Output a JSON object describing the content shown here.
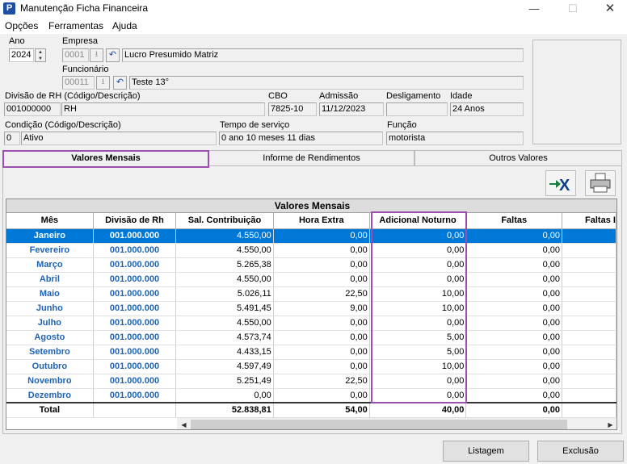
{
  "window": {
    "title": "Manutenção Ficha Financeira",
    "app_icon_letter": "P"
  },
  "menu": [
    "Opções",
    "Ferramentas",
    "Ajuda"
  ],
  "form": {
    "ano_label": "Ano",
    "ano_value": "2024",
    "empresa_label": "Empresa",
    "empresa_code": "0001",
    "empresa_name": "Lucro Presumido Matriz",
    "funcionario_label": "Funcionário",
    "funcionario_code": "00011",
    "funcionario_name": "Teste 13°",
    "divisao_label": "Divisão de RH (Código/Descrição)",
    "divisao_code": "001000000",
    "divisao_desc": "RH",
    "cbo_label": "CBO",
    "cbo_value": "7825-10",
    "admissao_label": "Admissão",
    "admissao_value": "11/12/2023",
    "desligamento_label": "Desligamento",
    "desligamento_value": "",
    "idade_label": "Idade",
    "idade_value": "24 Anos",
    "condicao_label": "Condição (Código/Descrição)",
    "condicao_code": "0",
    "condicao_desc": "Ativo",
    "tempo_label": "Tempo de serviço",
    "tempo_value": "0 ano 10 meses 11 dias",
    "funcao_label": "Função",
    "funcao_value": "motorista"
  },
  "tabs": [
    "Valores Mensais",
    "Informe de Rendimentos",
    "Outros Valores"
  ],
  "grid": {
    "title": "Valores Mensais",
    "columns": [
      "Mês",
      "Divisão de Rh",
      "Sal. Contribuição",
      "Hora Extra",
      "Adicional Noturno",
      "Faltas",
      "Faltas I"
    ],
    "rows": [
      [
        "Janeiro",
        "001.000.000",
        "4.550,00",
        "0,00",
        "0,00",
        "0,00"
      ],
      [
        "Fevereiro",
        "001.000.000",
        "4.550,00",
        "0,00",
        "0,00",
        "0,00"
      ],
      [
        "Março",
        "001.000.000",
        "5.265,38",
        "0,00",
        "0,00",
        "0,00"
      ],
      [
        "Abril",
        "001.000.000",
        "4.550,00",
        "0,00",
        "0,00",
        "0,00"
      ],
      [
        "Maio",
        "001.000.000",
        "5.026,11",
        "22,50",
        "10,00",
        "0,00"
      ],
      [
        "Junho",
        "001.000.000",
        "5.491,45",
        "9,00",
        "10,00",
        "0,00"
      ],
      [
        "Julho",
        "001.000.000",
        "4.550,00",
        "0,00",
        "0,00",
        "0,00"
      ],
      [
        "Agosto",
        "001.000.000",
        "4.573,74",
        "0,00",
        "5,00",
        "0,00"
      ],
      [
        "Setembro",
        "001.000.000",
        "4.433,15",
        "0,00",
        "5,00",
        "0,00"
      ],
      [
        "Outubro",
        "001.000.000",
        "4.597,49",
        "0,00",
        "10,00",
        "0,00"
      ],
      [
        "Novembro",
        "001.000.000",
        "5.251,49",
        "22,50",
        "0,00",
        "0,00"
      ],
      [
        "Dezembro",
        "001.000.000",
        "0,00",
        "0,00",
        "0,00",
        "0,00"
      ]
    ],
    "total": [
      "Total",
      "",
      "52.838,81",
      "54,00",
      "40,00",
      "0,00"
    ]
  },
  "buttons": {
    "listagem": "Listagem",
    "exclusao": "Exclusão"
  }
}
